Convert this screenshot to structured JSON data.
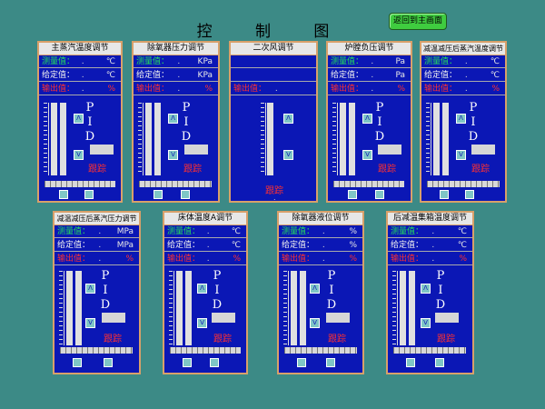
{
  "title": "控 制 图",
  "home_button": "返回到主画面",
  "labels": {
    "measured": "测量值：",
    "setpoint": "给定值：",
    "output": "输出值：",
    "dot": ".",
    "pid": [
      "P",
      "I",
      "D"
    ],
    "track": "跟踪",
    "up": "Λ",
    "down": "V"
  },
  "panels": [
    {
      "title": "主蒸汽温度调节",
      "units": [
        "℃",
        "℃",
        "%"
      ]
    },
    {
      "title": "除氧器压力调节",
      "units": [
        "KPa",
        "KPa",
        "%"
      ]
    },
    {
      "title": "二次风调节",
      "units": [
        "",
        "",
        ""
      ]
    },
    {
      "title": "炉膛负压调节",
      "units": [
        "Pa",
        "Pa",
        "%"
      ]
    },
    {
      "title": "减温减压后蒸汽温度调节",
      "units": [
        "℃",
        "℃",
        "%"
      ]
    },
    {
      "title": "减温减压后蒸汽压力调节",
      "units": [
        "MPa",
        "MPa",
        "%"
      ]
    },
    {
      "title": "床体温度A调节",
      "units": [
        "℃",
        "℃",
        "%"
      ]
    },
    {
      "title": "除氧器液位调节",
      "units": [
        "%",
        "%",
        "%"
      ]
    },
    {
      "title": "后减温集箱温度调节",
      "units": [
        "℃",
        "℃",
        "%"
      ]
    }
  ],
  "colors": {
    "background": "#3c8a86",
    "panel_border": "#d8a06a",
    "panel_body": "#0b17b5",
    "measured": "#24e05a",
    "output": "#ff3030"
  }
}
